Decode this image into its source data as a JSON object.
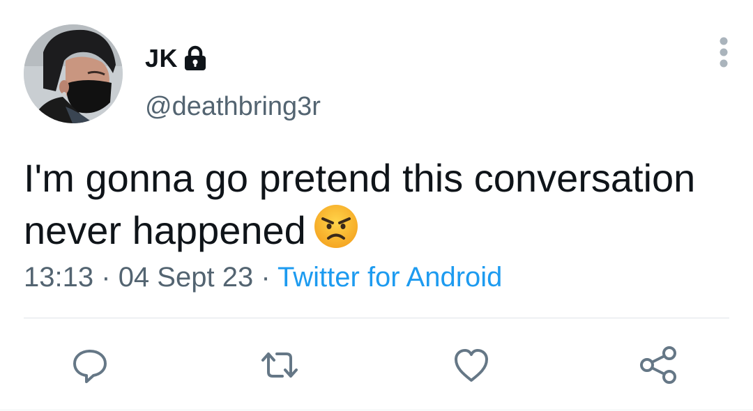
{
  "author": {
    "display_name": "JK",
    "handle": "@deathbring3r",
    "protected": true
  },
  "tweet": {
    "text": "I'm gonna go pretend this conversation never happened",
    "emoji": "angry-face-emoji"
  },
  "meta": {
    "time": "13:13",
    "separator1": "·",
    "date": "04 Sept 23",
    "separator2": "·",
    "source": "Twitter for Android"
  },
  "icons": {
    "lock": "lock-icon",
    "more": "more-vertical-icon",
    "reply": "reply-icon",
    "retweet": "retweet-icon",
    "like": "like-icon",
    "share": "share-icon"
  },
  "colors": {
    "text": "#0f1419",
    "secondary": "#536471",
    "link": "#1d9bf0",
    "divider": "#dfe4e8",
    "emoji_face": "#f7b92b"
  }
}
